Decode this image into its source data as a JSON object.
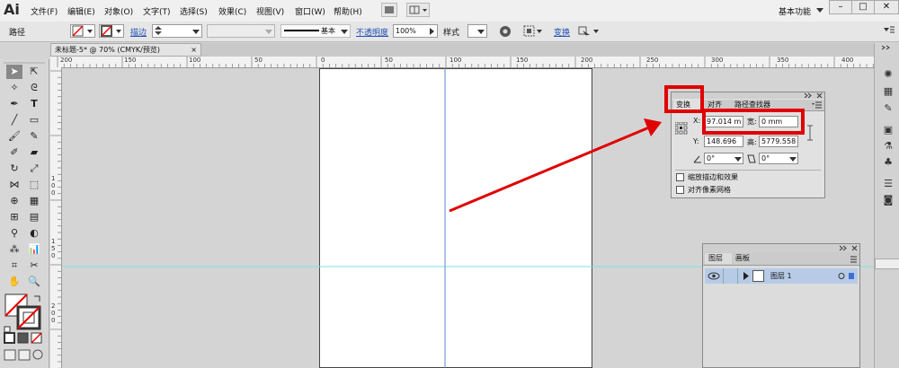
{
  "app": {
    "logo": "Ai"
  },
  "menu": [
    "文件(F)",
    "编辑(E)",
    "对象(O)",
    "文字(T)",
    "选择(S)",
    "效果(C)",
    "视图(V)",
    "窗口(W)",
    "帮助(H)"
  ],
  "workspace": {
    "label": "基本功能",
    "menu_icon": "chevron-down-icon"
  },
  "window_controls": {
    "minimize": "–",
    "restore": "□",
    "close": "✕"
  },
  "control_bar": {
    "path_label": "路径",
    "stroke_link": "描边",
    "brush_value": "基本",
    "opacity_link": "不透明度",
    "opacity_value": "100%",
    "style_label": "样式",
    "transform_link": "变换"
  },
  "document": {
    "tab": "未标题-5* @ 70% (CMYK/预览)",
    "close": "×"
  },
  "ruler": {
    "top": [
      "200",
      "150",
      "100",
      "50",
      "0",
      "50",
      "100",
      "150",
      "200",
      "250",
      "300",
      "350",
      "400"
    ],
    "left": [
      "1\n0\n0",
      "1\n5\n0",
      "2\n0\n0"
    ]
  },
  "transform_panel": {
    "tabs": [
      "变换",
      "对齐",
      "路径查找器"
    ],
    "x_label": "X:",
    "x_value": "97.014 m",
    "w_label": "宽:",
    "w_value": "0 mm",
    "y_label": "Y:",
    "y_value": "148.696",
    "h_label": "高:",
    "h_value": "5779.558",
    "rotate_value": "0°",
    "shear_value": "0°",
    "option_scale": "缩放描边和效果",
    "option_align": "对齐像素网格"
  },
  "layers_panel": {
    "tabs": [
      "图层",
      "画板"
    ],
    "layer_name": "图层 1"
  },
  "colors": {
    "annotation": "#e00000",
    "guide": "#7ee0e0",
    "center_line": "#5a8ec8",
    "layer_selected": "#b7cbe6"
  }
}
